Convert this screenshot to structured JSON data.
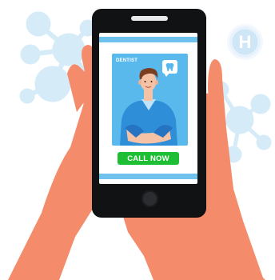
{
  "card": {
    "label": "DENTIST"
  },
  "call_button": {
    "label": "CALL NOW"
  },
  "hospital_badge": {
    "letter": "H"
  },
  "colors": {
    "screen_bars": "#6fc2ee",
    "card_background": "#5ab9ec",
    "call_button": "#1fbf35",
    "phone_body": "#111214",
    "skin": "#f48b6a",
    "molecule": "#d6ebf8"
  },
  "icons": {
    "bubble": "tooth-icon",
    "badge": "hospital-icon"
  }
}
